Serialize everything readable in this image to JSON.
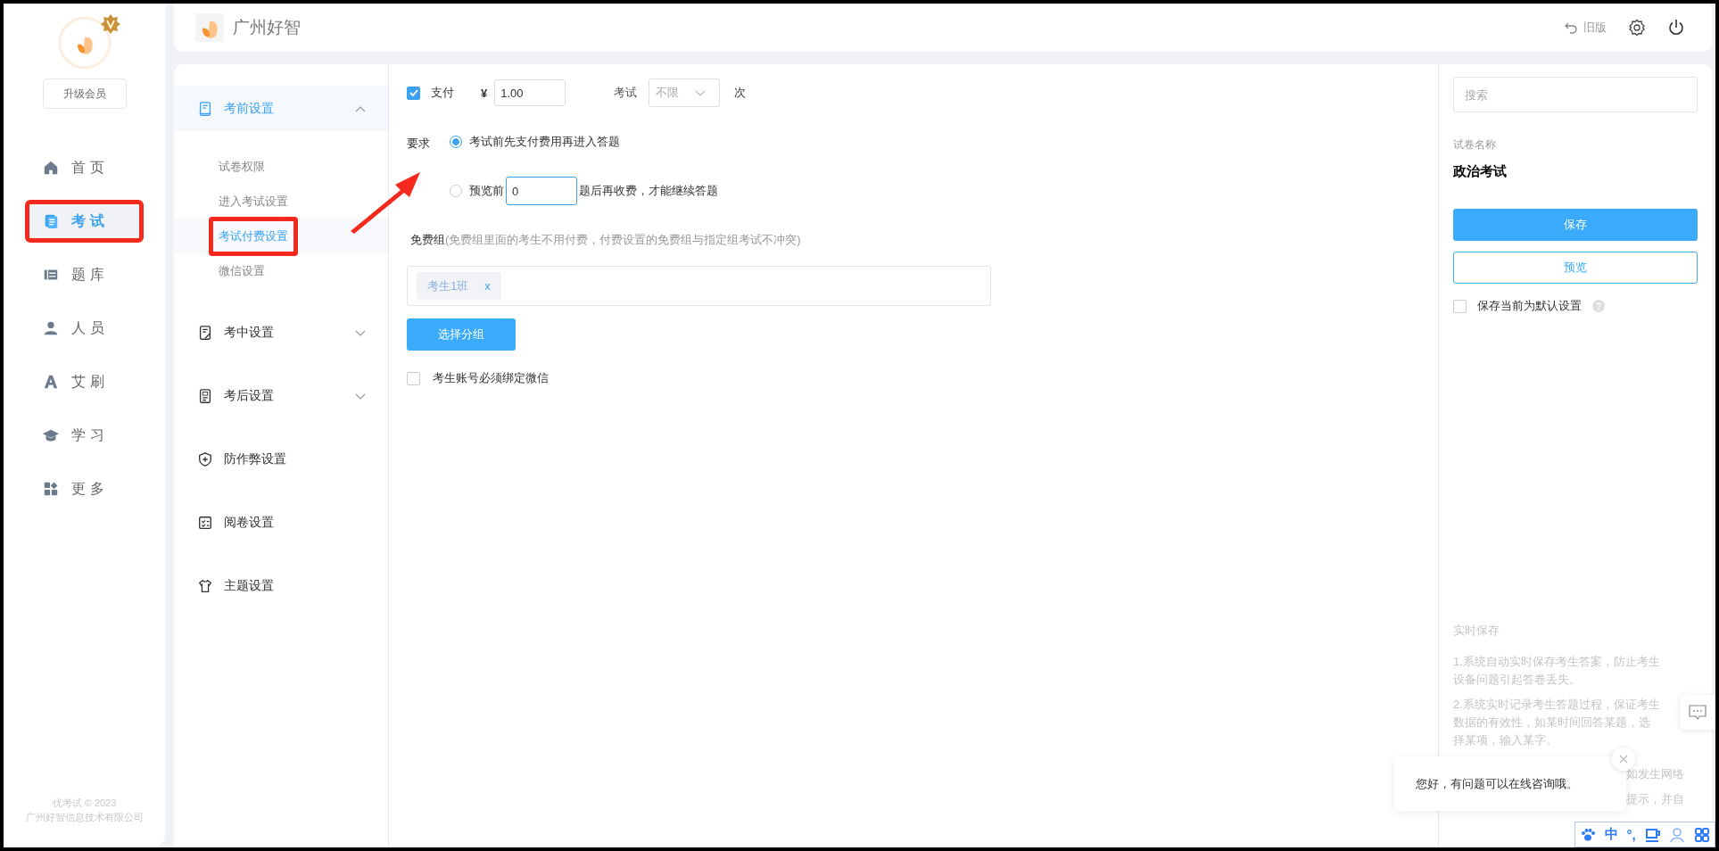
{
  "sidebar": {
    "upgrade_button": "升级会员",
    "items": [
      {
        "label": "首页",
        "selected": false,
        "highlighted": false
      },
      {
        "label": "考试",
        "selected": true,
        "highlighted": true
      },
      {
        "label": "题库",
        "selected": false,
        "highlighted": false
      },
      {
        "label": "人员",
        "selected": false,
        "highlighted": false
      },
      {
        "label": "艾刷",
        "selected": false,
        "highlighted": false
      },
      {
        "label": "学习",
        "selected": false,
        "highlighted": false
      },
      {
        "label": "更多",
        "selected": false,
        "highlighted": false
      }
    ],
    "footer": [
      "优考试 © 2023",
      "广州好智信息技术有限公司"
    ]
  },
  "header": {
    "title": "广州好智",
    "old_version": "旧版"
  },
  "settings_nav": [
    {
      "label": "考前设置",
      "expanded": true,
      "selected": true,
      "children": [
        {
          "label": "试卷权限",
          "selected": false,
          "highlighted": false
        },
        {
          "label": "进入考试设置",
          "selected": false,
          "highlighted": false
        },
        {
          "label": "考试付费设置",
          "selected": true,
          "highlighted": true
        },
        {
          "label": "微信设置",
          "selected": false,
          "highlighted": false
        }
      ]
    },
    {
      "label": "考中设置",
      "expanded": false,
      "selected": false
    },
    {
      "label": "考后设置",
      "expanded": false,
      "selected": false
    },
    {
      "label": "防作弊设置",
      "selected": false
    },
    {
      "label": "阅卷设置",
      "selected": false
    },
    {
      "label": "主题设置",
      "selected": false
    }
  ],
  "pointer_arrow": true,
  "payment": {
    "pay_checkbox": {
      "label": "支付",
      "checked": true
    },
    "currency": "¥",
    "price": "1.00",
    "exam_label": "考试",
    "attempts": "不限",
    "attempts_unit": "次",
    "requirement_label": "要求",
    "options": [
      {
        "kind": "plain",
        "label": "考试前先支付费用再进入答题",
        "selected": true
      },
      {
        "kind": "preview",
        "label": "预览前",
        "value": "0",
        "suffix": "题后再收费，才能继续答题",
        "selected": false
      }
    ],
    "free_group_label": "免费组",
    "free_group_hint": "(免费组里面的考生不用付费，付费设置的免费组与指定组考试不冲突)",
    "tags": [
      {
        "label": "考生1班",
        "remove": "x"
      }
    ],
    "select_group_button": "选择分组",
    "bind_wechat": {
      "label": "考生账号必须绑定微信",
      "checked": false
    }
  },
  "right_panel": {
    "search_placeholder": "搜索",
    "paper_name_label": "试卷名称",
    "paper_name": "政治考试",
    "save_button": "保存",
    "preview_button": "预览",
    "default_checkbox": {
      "label": "保存当前为默认设置",
      "checked": false
    },
    "help_title": "实时保存",
    "help_paragraphs": [
      "1.系统自动实时保存考生答案，防止考生设备问题引起答卷丢失。",
      "2.系统实时记录考生答题过程，保证考生数据的有效性，如某时间回答某题，选择某项，输入某字。"
    ],
    "help_fragment": [
      "如发生网络",
      "提示，并自"
    ]
  },
  "chat_popup": {
    "message": "您好，有问题可以在线咨询哦。"
  },
  "ime_toolbar": {
    "items": [
      {
        "kind": "icon"
      },
      {
        "kind": "text",
        "label": "中"
      },
      {
        "kind": "text",
        "label": "°,"
      },
      {
        "kind": "icon"
      },
      {
        "kind": "icon"
      },
      {
        "kind": "icon"
      }
    ]
  }
}
